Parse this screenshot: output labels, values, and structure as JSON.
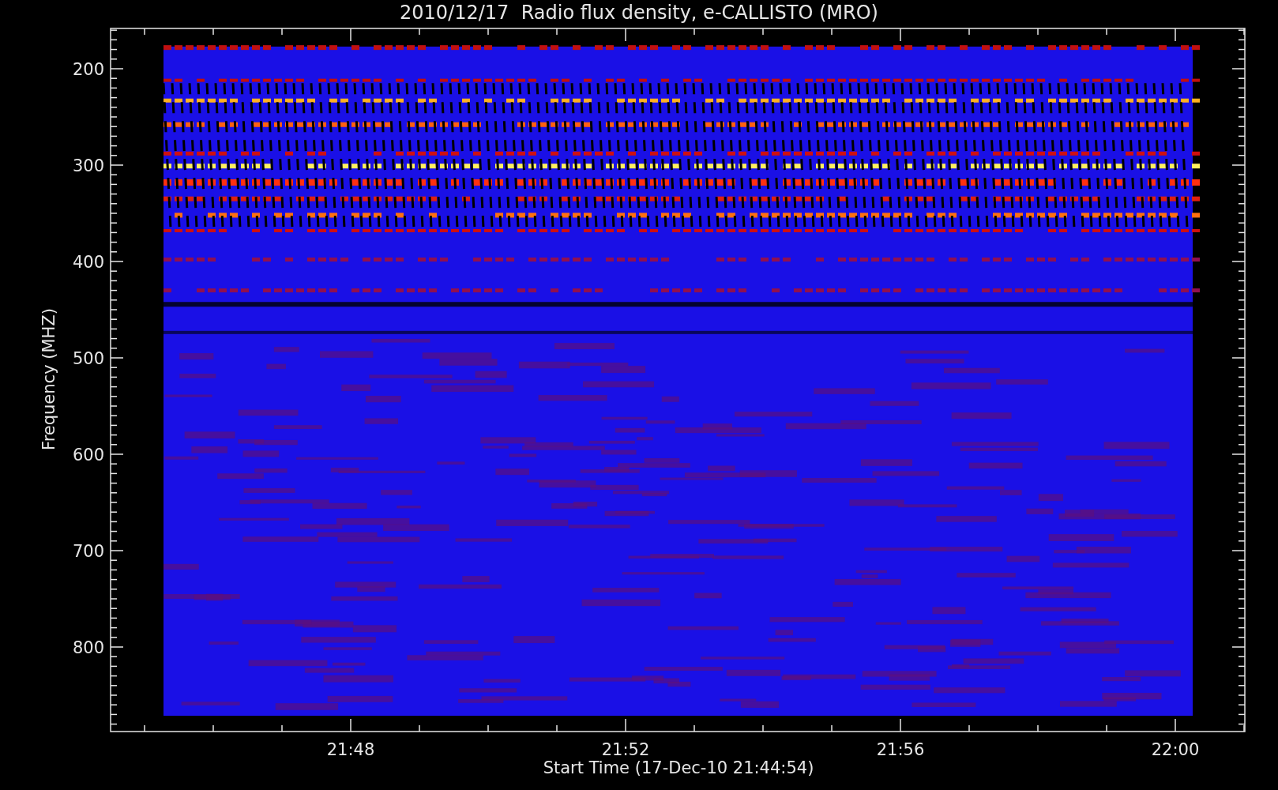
{
  "title": "2010/12/17  Radio flux density, e-CALLISTO (MRO)",
  "plot": {
    "ylabel": "Frequency (MHZ)",
    "xlabel": "Start Time (17-Dec-10 21:44:54)",
    "yticks": [
      "200",
      "300",
      "400",
      "500",
      "600",
      "700",
      "800"
    ],
    "xticks": [
      "21:48",
      "21:52",
      "21:56",
      "22:00"
    ]
  }
}
